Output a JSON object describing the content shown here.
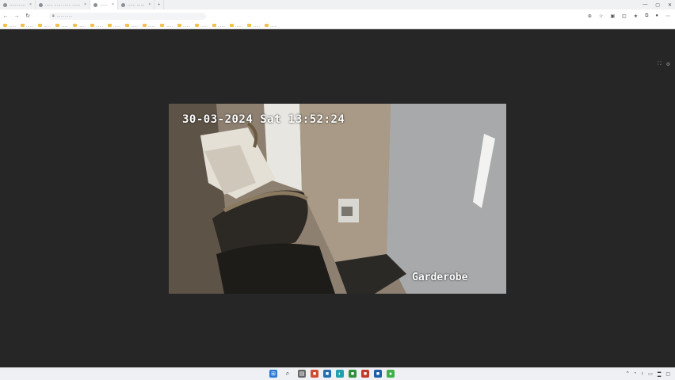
{
  "browser": {
    "tabs": [
      {
        "label": "…………",
        "active": false
      },
      {
        "label": "…… …… …… ……",
        "active": false
      },
      {
        "label": "……",
        "active": true
      },
      {
        "label": "…… ……",
        "active": false
      }
    ],
    "address": "…………"
  },
  "bookmarks": [
    "……",
    "……",
    "……",
    "……",
    "……",
    "……",
    "……",
    "……",
    "……",
    "……",
    "……",
    "……",
    "……",
    "……",
    "……",
    "……"
  ],
  "camera": {
    "timestamp": "30-03-2024 Sat 13:52:24",
    "name": "Garderobe"
  },
  "colors": {
    "page_bg": "#262626",
    "osd_text": "#ffffff",
    "taskbar_bg": "#eef0f3"
  }
}
